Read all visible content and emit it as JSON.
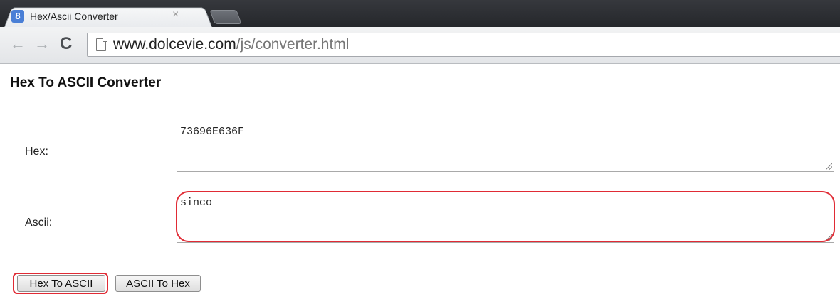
{
  "browser": {
    "tab_title": "Hex/Ascii Converter",
    "tab_close": "×",
    "favicon_letter": "8",
    "favicon_color": "#4a7fd6",
    "url_domain": "www.dolcevie.com",
    "url_path": "/js/converter.html"
  },
  "page": {
    "title": "Hex To ASCII Converter",
    "hex_label": "Hex:",
    "hex_value": "73696E636F",
    "ascii_label": "Ascii:",
    "ascii_value": "sinco",
    "button_hex_to_ascii": "Hex To ASCII",
    "button_ascii_to_hex": "ASCII To Hex"
  },
  "annotations": {
    "highlight_color": "#e02b35"
  }
}
